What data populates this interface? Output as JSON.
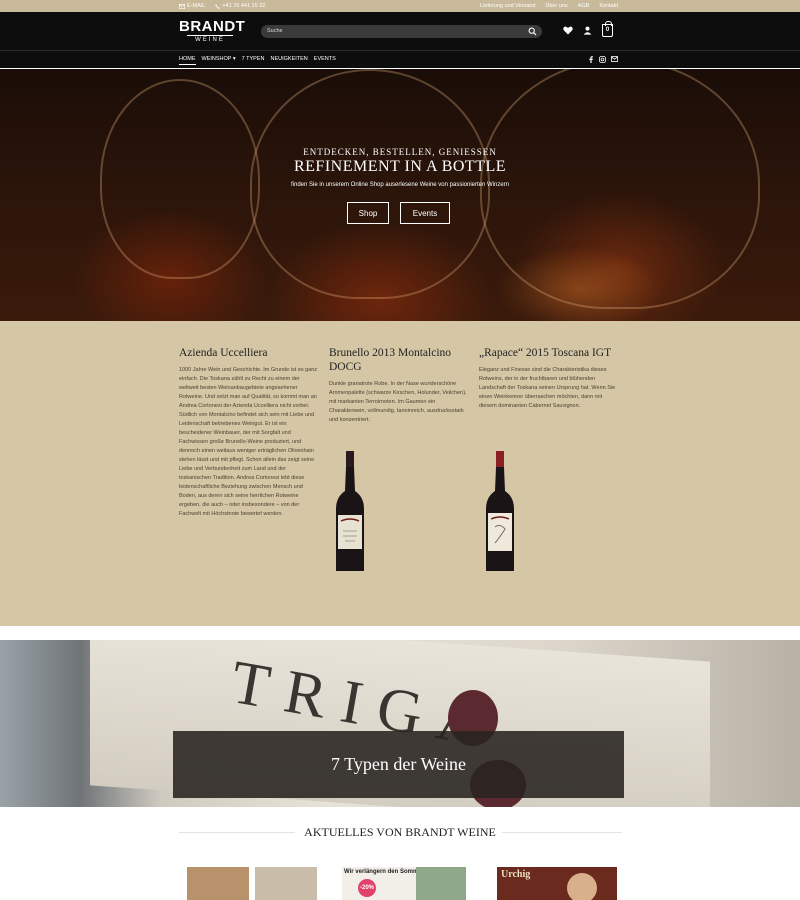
{
  "topbar": {
    "email_label": "E-MAIL",
    "phone": "+41 76 441 15 22",
    "links": [
      "Lieferung und Versand",
      "Über uns",
      "AGB",
      "Kontakt"
    ]
  },
  "header": {
    "logo_main": "BRANDT",
    "logo_sub": "WEINE",
    "search_placeholder": "Suche",
    "cart_count": "0"
  },
  "nav": {
    "items": [
      "HOME",
      "WEINSHOP",
      "7 TYPEN",
      "NEUIGKEITEN",
      "EVENTS"
    ]
  },
  "hero": {
    "kicker": "ENTDECKEN, BESTELLEN, GENIESSEN",
    "headline": "REFINEMENT IN A BOTTLE",
    "tagline": "finden Sie in unserem Online Shop auserlesene Weine von passionierten Winzern",
    "button_shop": "Shop",
    "button_events": "Events"
  },
  "columns": [
    {
      "title": "Azienda Uccelliera",
      "text": "1000 Jahre Wein und Geschichte. Im Grunde ist es ganz einfach. Die Toskana zählt zu Recht zu einem der weltweit besten Weinanbaugebiete angesehener Rotweine. Und setzt man auf Qualität, so kommt man an Andrea Cortonesi der Azienda Uccelliera nicht vorbei. Südlich von Montalcino befindet sich sein mit Liebe und Leidenschaft betriebenes Weingut. Er ist ein bescheidener Weinbauer, der mit Sorgfalt und Fachwissen große Brunello-Weine produziert, und dennoch einen weitaus weniger erträglichen Olivenhain stehen lässt und mit pflegt. Schon allein das zeigt seine Liebe und Verbundenheit zum Land und der toskanischen Tradition. Andrea Cortonesi lebt diese leidenschaftliche Beziehung zwischen Mensch und Boden, aus deren sich seine herrlichen Rotweine ergeben, die auch – oder insbesondere – von der Fachwelt mit Höchstnote bewertet werden."
    },
    {
      "title": "Brunello 2013 Montalcino DOCG",
      "text": "Dunkle granatrote Robe. In der Nase wunderschöne Aromenpalette (schwarze Kirschen, Holunder, Veilchen), mit markanten Terroirnoten. Im Gaumen ein Charakterwein, vollmundig, tanninreich, ausdrucksstark und konzentriert."
    },
    {
      "title": "„Rapace“ 2015 Toscana IGT",
      "text": "Eleganz und Finesse sind die Charakteristika dieses Rotweins, der in der fruchtbaren und blühenden Landschaft der Toskana seinen Ursprung hat. Wenn Sie einen Weinkenner überraschen möchten, dann mit diesem dominanten Cabernet Sauvignon."
    }
  ],
  "crate": {
    "word": "TRIGA",
    "caption": "7 Typen der Weine"
  },
  "news": {
    "heading": "AKTUELLES VON BRANDT WEINE",
    "promo_text": "Wir verlängern den Sommer!",
    "promo_badge": "-20%",
    "event_label": "Urchig"
  },
  "colors": {
    "topbar": "#c7b99a",
    "header": "#0d0d0d",
    "band": "#d5c7a5"
  }
}
